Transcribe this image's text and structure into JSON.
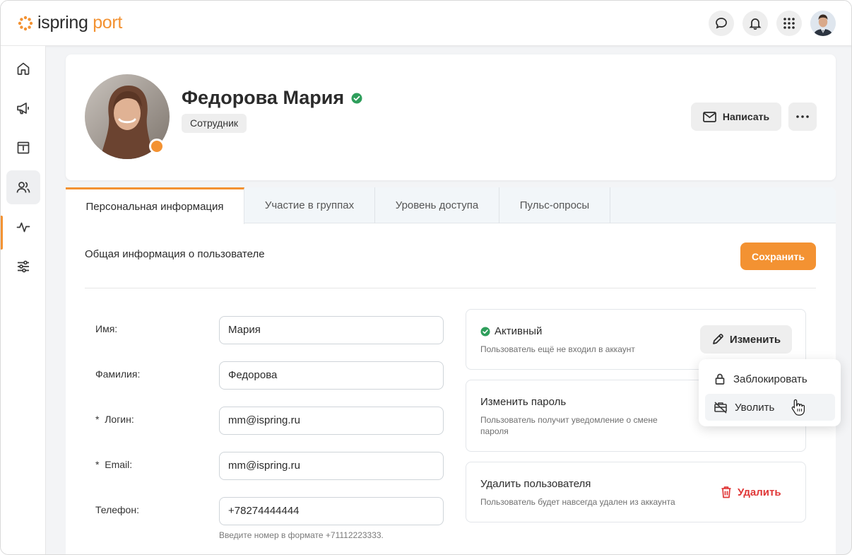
{
  "brand": {
    "logo_part1": "ispring",
    "logo_part2": "port",
    "accent_color": "#f39232"
  },
  "topbar": {
    "icons": [
      "chat-icon",
      "bell-icon",
      "apps-grid-icon"
    ],
    "user_avatar": "user-avatar"
  },
  "sidebar": {
    "items": [
      {
        "icon": "home-icon",
        "active": false
      },
      {
        "icon": "megaphone-icon",
        "active": false
      },
      {
        "icon": "catalog-icon",
        "active": false
      },
      {
        "icon": "users-icon",
        "active": true
      },
      {
        "icon": "activity-icon",
        "active": false
      },
      {
        "icon": "settings-sliders-icon",
        "active": false
      }
    ]
  },
  "profile": {
    "name": "Федорова Мария",
    "role": "Сотрудник",
    "verified": true,
    "online_status_color": "#f39232",
    "write_button": "Написать"
  },
  "tabs": [
    {
      "label": "Персональная информация",
      "active": true
    },
    {
      "label": "Участие в группах",
      "active": false
    },
    {
      "label": "Уровень доступа",
      "active": false
    },
    {
      "label": "Пульс-опросы",
      "active": false
    }
  ],
  "form": {
    "section_title": "Общая информация о пользователе",
    "save_button": "Сохранить",
    "fields": [
      {
        "label": "Имя:",
        "value": "Мария"
      },
      {
        "label": "Фамилия:",
        "value": "Федорова"
      },
      {
        "label": "*  Логин:",
        "value": "mm@ispring.ru"
      },
      {
        "label": "*  Email:",
        "value": "mm@ispring.ru"
      },
      {
        "label": "Телефон:",
        "value": "+78274444444"
      }
    ],
    "phone_hint": "Введите номер в формате +71112223333."
  },
  "status_card": {
    "title": "Активный",
    "subtitle": "Пользователь ещё не входил в аккаунт",
    "edit_button": "Изменить",
    "status_color": "#2e9e5b"
  },
  "password_card": {
    "title": "Изменить пароль",
    "subtitle": "Пользователь получит уведомление о смене пароля"
  },
  "delete_card": {
    "title": "Удалить пользователя",
    "subtitle": "Пользователь будет навсегда удален из аккаунта",
    "delete_button": "Удалить",
    "danger_color": "#e03838"
  },
  "dropdown": {
    "items": [
      {
        "label": "Заблокировать",
        "icon": "lock-icon"
      },
      {
        "label": "Уволить",
        "icon": "dismiss-briefcase-icon"
      }
    ]
  }
}
